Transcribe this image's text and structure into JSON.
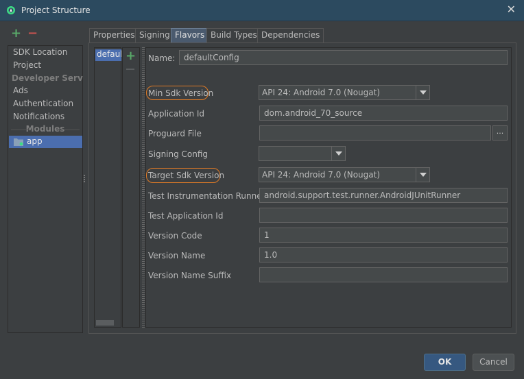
{
  "window": {
    "title": "Project Structure"
  },
  "sidebar": {
    "items": [
      {
        "label": "SDK Location"
      },
      {
        "label": "Project"
      }
    ],
    "developer_header": "Developer Servi...",
    "dev_items": [
      {
        "label": "Ads"
      },
      {
        "label": "Authentication"
      },
      {
        "label": "Notifications"
      }
    ],
    "modules_header": "Modules",
    "module": {
      "label": "app"
    }
  },
  "tabs": [
    {
      "label": "Properties"
    },
    {
      "label": "Signing"
    },
    {
      "label": "Flavors",
      "active": true
    },
    {
      "label": "Build Types"
    },
    {
      "label": "Dependencies"
    }
  ],
  "flavors": {
    "selected": "default"
  },
  "form": {
    "name_label": "Name:",
    "name_value": "defaultConfig",
    "min_sdk_label": "Min Sdk Version",
    "min_sdk_value": "API 24: Android 7.0 (Nougat)",
    "app_id_label": "Application Id",
    "app_id_value": "dom.android_70_source",
    "proguard_label": "Proguard File",
    "proguard_value": "",
    "proguard_browse": "...",
    "signing_label": "Signing Config",
    "signing_value": "",
    "target_sdk_label": "Target Sdk Version",
    "target_sdk_value": "API 24: Android 7.0 (Nougat)",
    "test_runner_label": "Test Instrumentation Runner",
    "test_runner_value": "android.support.test.runner.AndroidJUnitRunner",
    "test_app_id_label": "Test Application Id",
    "test_app_id_value": "",
    "version_code_label": "Version Code",
    "version_code_value": "1",
    "version_name_label": "Version Name",
    "version_name_value": "1.0",
    "version_suffix_label": "Version Name Suffix",
    "version_suffix_value": ""
  },
  "buttons": {
    "ok": "OK",
    "cancel": "Cancel"
  },
  "colors": {
    "accent_highlight": "#e07b26",
    "selection": "#4b6eaf",
    "add": "#59a869",
    "remove": "#c75450"
  }
}
